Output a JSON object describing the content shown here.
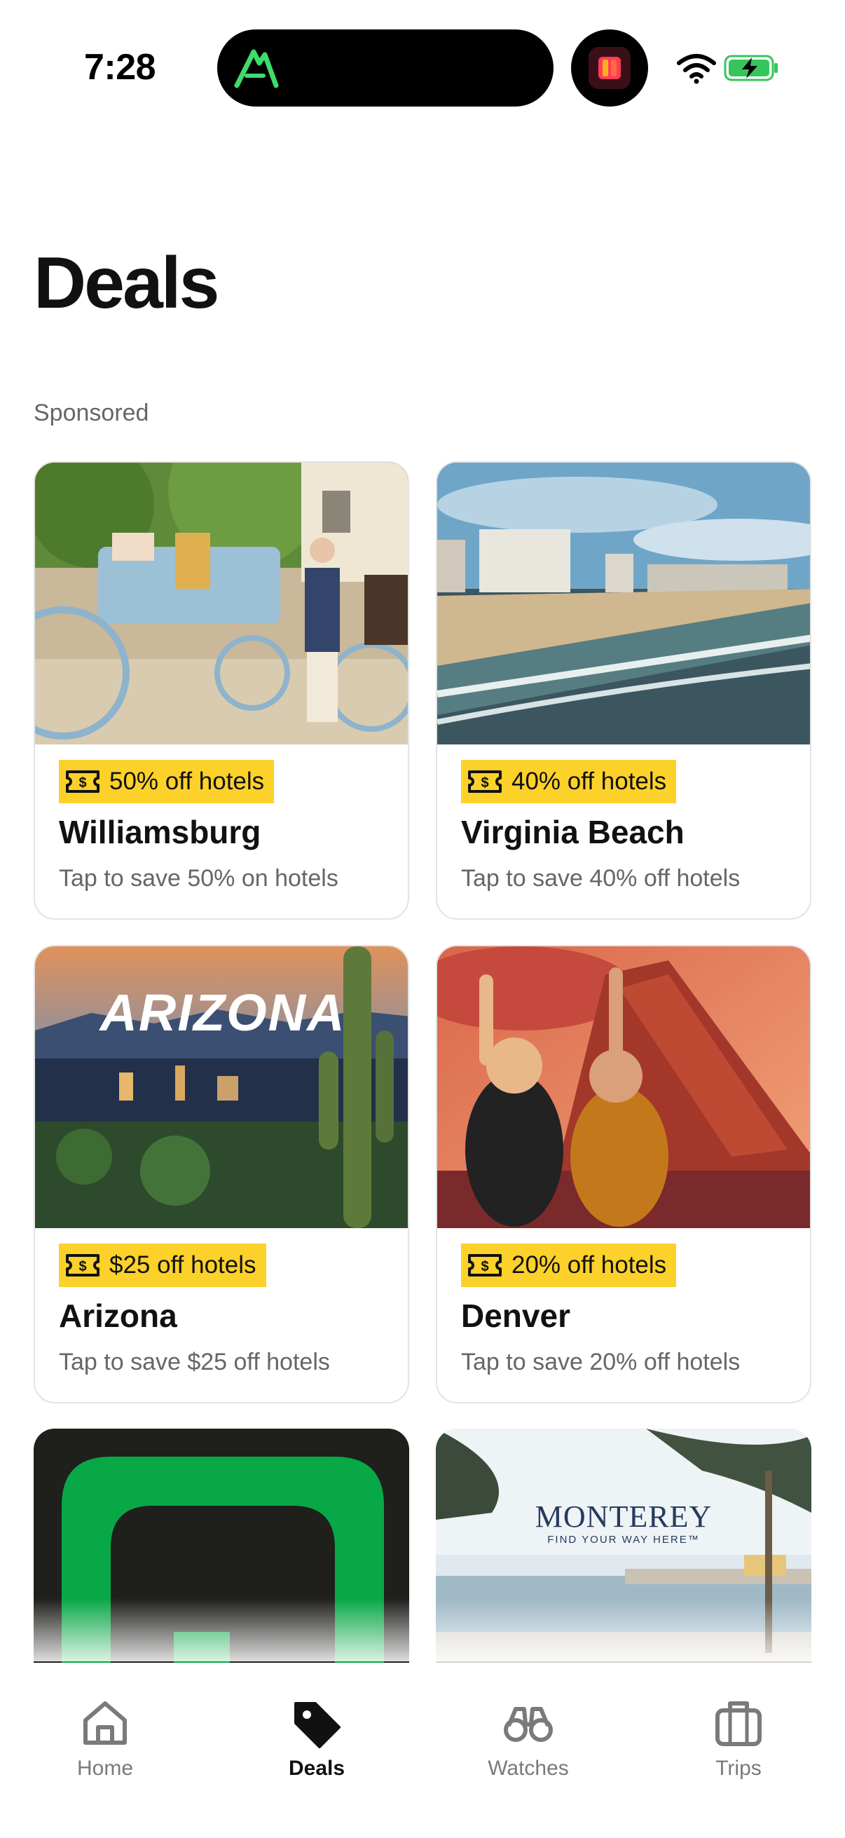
{
  "status_bar": {
    "time": "7:28",
    "island_app_icon": "alltrails-mountain-icon",
    "secondary_app_icon": "app-icon",
    "wifi_icon": "wifi-icon",
    "battery_icon": "battery-charging-icon",
    "battery_color": "#36c55b"
  },
  "page": {
    "title": "Deals",
    "section_label": "Sponsored"
  },
  "deals": [
    {
      "badge": "50% off hotels",
      "title": "Williamsburg",
      "subtitle": "Tap to save 50% on hotels",
      "image": "horse-carriage-photo"
    },
    {
      "badge": "40% off hotels",
      "title": "Virginia Beach",
      "subtitle": "Tap to save 40% off hotels",
      "image": "beach-aerial-photo"
    },
    {
      "badge": "$25 off hotels",
      "title": "Arizona",
      "subtitle": "Tap to save $25 off hotels",
      "image": "arizona-city-photo",
      "image_text": "ARIZONA"
    },
    {
      "badge": "20% off hotels",
      "title": "Denver",
      "subtitle": "Tap to save 20% off hotels",
      "image": "red-rocks-concert-photo"
    },
    {
      "badge": "",
      "title": "",
      "subtitle": "",
      "image": "green-logo-graphic"
    },
    {
      "badge": "",
      "title": "",
      "subtitle": "",
      "image": "monterey-coast-photo",
      "image_text": "MONTEREY",
      "image_tagline": "FIND YOUR WAY HERE™"
    }
  ],
  "badge_color": "#fcd12a",
  "bottom_nav": {
    "items": [
      {
        "label": "Home",
        "icon": "home-icon",
        "active": false
      },
      {
        "label": "Deals",
        "icon": "tag-icon",
        "active": true
      },
      {
        "label": "Watches",
        "icon": "binoculars-icon",
        "active": false
      },
      {
        "label": "Trips",
        "icon": "suitcase-icon",
        "active": false
      }
    ]
  }
}
